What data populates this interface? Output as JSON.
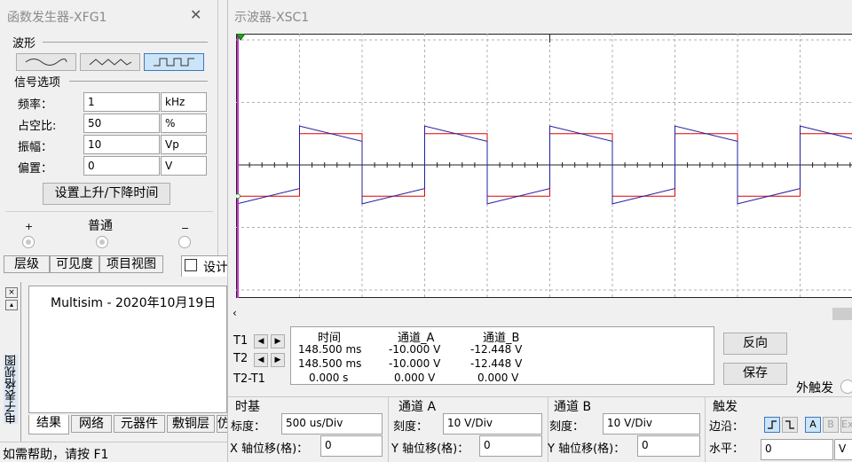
{
  "fg": {
    "title": "函数发生器-XFG1",
    "close": "✕",
    "waveform_title": "波形",
    "signal_title": "信号选项",
    "rows": [
      {
        "label": "频率：",
        "value": "1",
        "unit": "kHz"
      },
      {
        "label": "占空比:",
        "value": "50",
        "unit": "%"
      },
      {
        "label": "振幅：",
        "value": "10",
        "unit": "Vp"
      },
      {
        "label": "偏置：",
        "value": "0",
        "unit": "V"
      }
    ],
    "rise_fall_button": "设置上升/下降时间",
    "plus": "+",
    "common": "普通",
    "minus": "−"
  },
  "tabs_top": [
    "层级",
    "可见度",
    "项目视图"
  ],
  "design_tab": "设计",
  "side_label": "电子表格视图",
  "spreadsheet": {
    "log": "Multisim  -  2020年10月19日",
    "tabs": [
      "结果",
      "网络",
      "元器件",
      "敷铜层",
      "仿"
    ]
  },
  "status_bar": "如需帮助，请按 F1",
  "scope": {
    "title": "示波器-XSC1",
    "chart_data": {
      "type": "line",
      "grid_divisions_x": 10,
      "grid_divisions_y": 8,
      "x_unit": "div",
      "y_unit": "div",
      "series": [
        {
          "color": "#e00000",
          "type": "square",
          "high_div": 1,
          "low_div": -1,
          "period_div": 2,
          "first_rise_div": 1
        },
        {
          "color": "#2020a0",
          "type": "rc-coupled",
          "peak_div": 1.245,
          "sag_div": 0.755,
          "period_div": 2,
          "first_rise_div": 1
        }
      ]
    },
    "readout": {
      "headers": {
        "time": "时间",
        "a": "通道_A",
        "b": "通道_B"
      },
      "rows": [
        {
          "label": "T1",
          "time": "148.500 ms",
          "a": "-10.000 V",
          "b": "-12.448 V"
        },
        {
          "label": "T2",
          "time": "148.500 ms",
          "a": "-10.000 V",
          "b": "-12.448 V"
        },
        {
          "label": "T2-T1",
          "time": "0.000 s",
          "a": "0.000 V",
          "b": "0.000 V"
        }
      ],
      "arrow_left": "◀",
      "arrow_right": "▶"
    },
    "reverse_button": "反向",
    "save_button": "保存",
    "ext_trigger": "外触发",
    "timebase": {
      "title": "时基",
      "scale_label": "标度：",
      "scale_value": "500 us/Div",
      "pos_label": "X 轴位移(格)：",
      "pos_value": "0"
    },
    "channel_a": {
      "title": "通道 A",
      "scale_label": "刻度：",
      "scale_value": "10  V/Div",
      "pos_label": "Y 轴位移(格)：",
      "pos_value": "0"
    },
    "channel_b": {
      "title": "通道 B",
      "scale_label": "刻度：",
      "scale_value": "10  V/Div",
      "pos_label": "Y 轴位移(格)：",
      "pos_value": "0"
    },
    "trigger": {
      "title": "触发",
      "edge_label": "边沿：",
      "level_label": "水平：",
      "level_value": "0",
      "level_unit": "V",
      "src_a": "A",
      "src_b": "B",
      "src_ext": "Ext"
    }
  }
}
